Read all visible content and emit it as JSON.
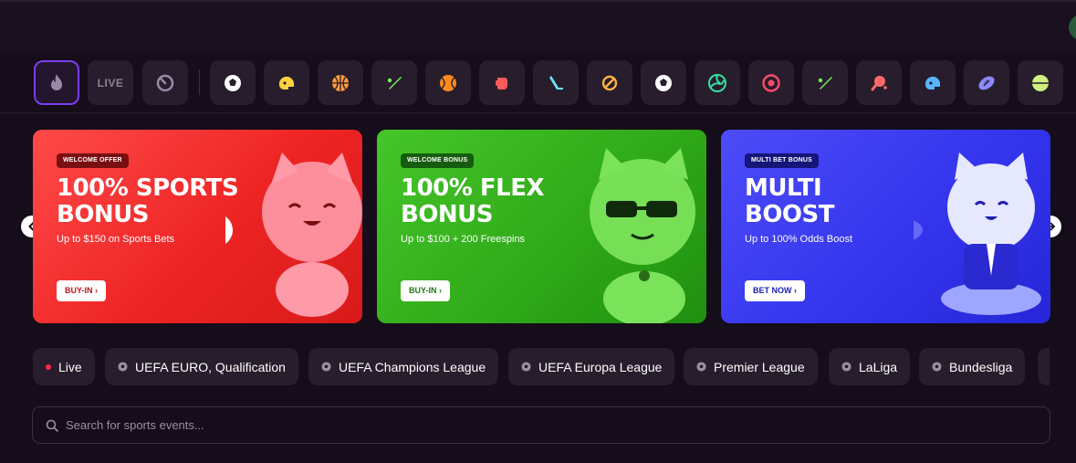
{
  "sports_nav": {
    "live_label": "LIVE",
    "items": [
      {
        "icon": "soccer-ball-icon",
        "color": "#ffffff"
      },
      {
        "icon": "football-helmet-icon",
        "color": "#ffd23f"
      },
      {
        "icon": "basketball-icon",
        "color": "#ff9a3c"
      },
      {
        "icon": "cricket-bat-icon",
        "color": "#7bef5a"
      },
      {
        "icon": "tennis-ball-icon",
        "color": "#ff8a1e"
      },
      {
        "icon": "boxing-glove-icon",
        "color": "#ff5a5a"
      },
      {
        "icon": "hockey-stick-icon",
        "color": "#6ae6ff"
      },
      {
        "icon": "esports-icon",
        "color": "#ffb347"
      },
      {
        "icon": "soccer-ball-icon",
        "color": "#ffffff"
      },
      {
        "icon": "volleyball-icon",
        "color": "#35e0a0"
      },
      {
        "icon": "darts-target-icon",
        "color": "#ff4a6a"
      },
      {
        "icon": "cricket-bat-icon",
        "color": "#7bef5a"
      },
      {
        "icon": "table-tennis-icon",
        "color": "#ff6a6a"
      },
      {
        "icon": "football-helmet-icon",
        "color": "#5ab4ff"
      },
      {
        "icon": "rugby-ball-icon",
        "color": "#8a8aff"
      },
      {
        "icon": "ball-icon",
        "color": "#d0ef80"
      }
    ]
  },
  "banners": [
    {
      "tag": "WELCOME OFFER",
      "title_line1": "100% SPORTS",
      "title_line2": "BONUS",
      "subtitle": "Up to $150 on Sports Bets",
      "cta": "BUY-IN ›",
      "color": "#ee2424"
    },
    {
      "tag": "WELCOME BONUS",
      "title_line1": "100% FLEX",
      "title_line2": "BONUS",
      "subtitle": "Up to $100 + 200 Freespins",
      "cta": "BUY-IN ›",
      "color": "#2ea818"
    },
    {
      "tag": "MULTI BET BONUS",
      "title_line1": "MULTI",
      "title_line2": "BOOST",
      "subtitle": "Up to 100% Odds Boost",
      "cta": "BET NOW ›",
      "color": "#3535ee"
    }
  ],
  "leagues": [
    {
      "label": "Live",
      "kind": "live"
    },
    {
      "label": "UEFA EURO, Qualification",
      "kind": "soccer"
    },
    {
      "label": "UEFA Champions League",
      "kind": "soccer"
    },
    {
      "label": "UEFA Europa League",
      "kind": "soccer"
    },
    {
      "label": "Premier League",
      "kind": "soccer"
    },
    {
      "label": "LaLiga",
      "kind": "soccer"
    },
    {
      "label": "Bundesliga",
      "kind": "soccer"
    }
  ],
  "search": {
    "placeholder": "Search for sports events..."
  },
  "colors": {
    "background": "#150d19",
    "chip": "#271d2c",
    "accent": "#7c3df2",
    "live_dot": "#ff2a4a"
  }
}
